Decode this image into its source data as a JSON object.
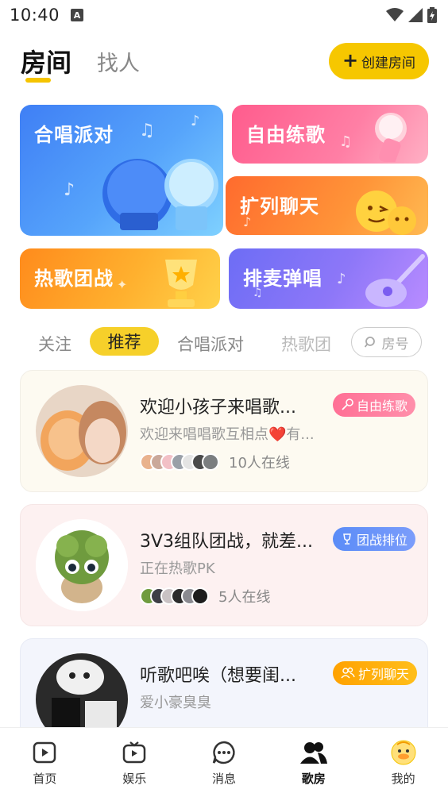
{
  "status_bar": {
    "time": "10:40",
    "indicator": "A"
  },
  "header": {
    "tabs": [
      {
        "label": "房间"
      },
      {
        "label": "找人"
      }
    ],
    "create_button": "创建房间"
  },
  "categories": [
    {
      "label": "合唱派对"
    },
    {
      "label": "自由练歌"
    },
    {
      "label": "扩列聊天"
    },
    {
      "label": "热歌团战"
    },
    {
      "label": "排麦弹唱"
    }
  ],
  "filters": {
    "items": [
      "关注",
      "推荐",
      "合唱派对",
      "热歌团"
    ],
    "active": "推荐",
    "room_number_placeholder": "房号"
  },
  "rooms": [
    {
      "title": "欢迎小孩子来唱歌...",
      "desc": "欢迎来唱唱歌互相点❤️有...",
      "tag": "自由练歌",
      "online": "10人在线"
    },
    {
      "title": "3V3组队团战，就差...",
      "desc": "正在热歌PK",
      "tag": "团战排位",
      "online": "5人在线"
    },
    {
      "title": "听歌吧唉（想要闺...",
      "desc": "爱小豪臭臭",
      "tag": "扩列聊天",
      "online": ""
    }
  ],
  "bottom_nav": [
    {
      "label": "首页",
      "icon": "play-square-icon"
    },
    {
      "label": "娱乐",
      "icon": "tv-icon"
    },
    {
      "label": "消息",
      "icon": "chat-bubble-icon"
    },
    {
      "label": "歌房",
      "icon": "people-icon",
      "active": true
    },
    {
      "label": "我的",
      "icon": "duck-avatar-icon"
    }
  ],
  "colors": {
    "accent": "#f6c700",
    "pink": "#ff6f95",
    "blue": "#5b8cf7",
    "orange": "#ffa200"
  }
}
